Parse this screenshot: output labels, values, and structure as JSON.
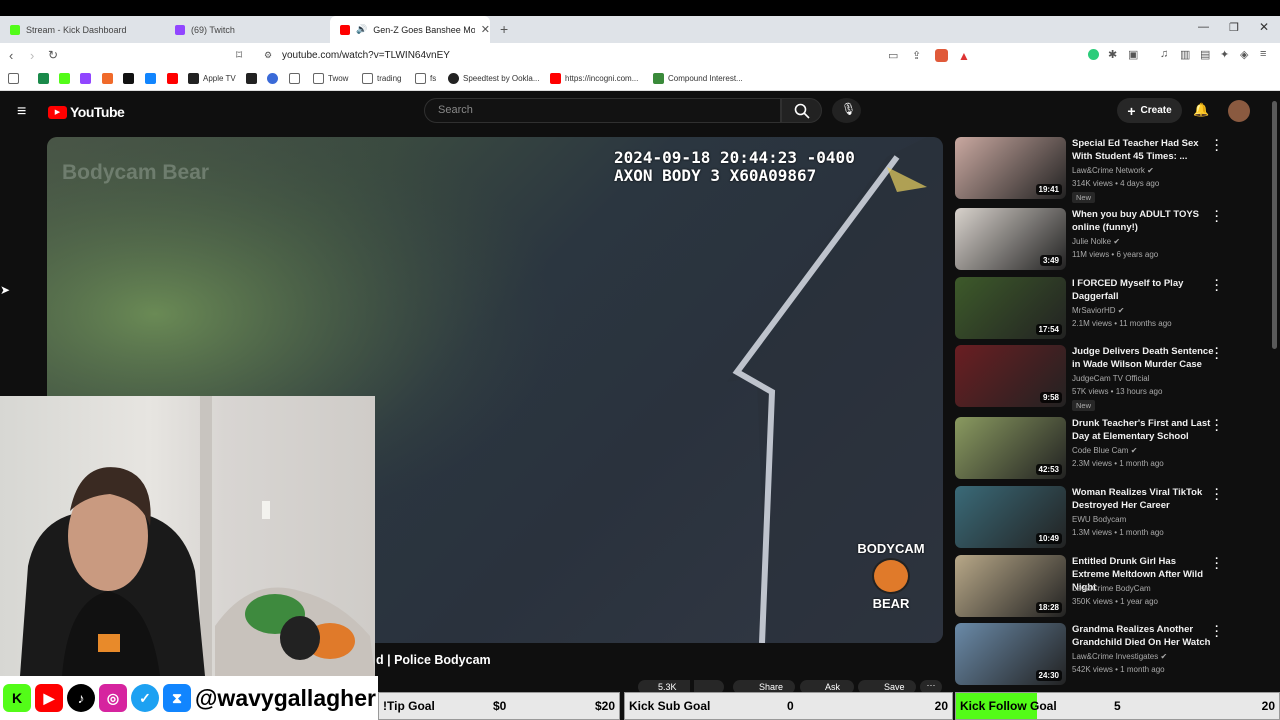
{
  "browser": {
    "tabs": [
      {
        "label": "Stream - Kick Dashboard",
        "color": "#53fc18"
      },
      {
        "label": "(69) Twitch",
        "color": "#9146ff"
      },
      {
        "label": "Gen-Z Goes Banshee Mode O",
        "color": "#ff0000"
      }
    ],
    "url": "youtube.com/watch?v=TLWIN64vnEY",
    "bookmarks": [
      "Apple TV",
      "Twow",
      "trading",
      "fs",
      "Speedtest by Ookla...",
      "https://incogni.com...",
      "Compound Interest..."
    ]
  },
  "youtube": {
    "logo": "YouTube",
    "search_placeholder": "Search",
    "create_label": "Create",
    "video": {
      "overlay_channel": "Bodycam Bear",
      "timestamp": "2024-09-18 20:44:23 -0400",
      "camera": "AXON BODY 3 X60A09867",
      "watermark_top": "BODYCAM",
      "watermark_bottom": "BEAR",
      "title_fragment": "d | Police Bodycam",
      "likes": "5.3K",
      "share": "Share",
      "ask": "Ask",
      "save": "Save"
    },
    "suggestions": [
      {
        "title": "Special Ed Teacher Had Sex With Student 45 Times: ...",
        "channel": "Law&Crime Network",
        "verified": true,
        "meta": "314K views • 4 days ago",
        "badge": "New",
        "duration": "19:41",
        "thumb": "#c9a8a0"
      },
      {
        "title": "When you buy ADULT TOYS online (funny!)",
        "channel": "Julie Nolke",
        "verified": true,
        "meta": "11M views • 6 years ago",
        "badge": "",
        "duration": "3:49",
        "thumb": "#d8d2cc"
      },
      {
        "title": "I FORCED Myself to Play Daggerfall",
        "channel": "MrSaviorHD",
        "verified": true,
        "meta": "2.1M views • 11 months ago",
        "badge": "",
        "duration": "17:54",
        "thumb": "#3d5a2a"
      },
      {
        "title": "Judge Delivers Death Sentence in Wade Wilson Murder Case",
        "channel": "JudgeCam TV Official",
        "verified": false,
        "meta": "57K views • 13 hours ago",
        "badge": "New",
        "duration": "9:58",
        "thumb": "#6a1e22"
      },
      {
        "title": "Drunk Teacher's First and Last Day at Elementary School",
        "channel": "Code Blue Cam",
        "verified": true,
        "meta": "2.3M views • 1 month ago",
        "badge": "",
        "duration": "42:53",
        "thumb": "#8a9a60"
      },
      {
        "title": "Woman Realizes Viral TikTok Destroyed Her Career",
        "channel": "EWU Bodycam",
        "verified": false,
        "meta": "1.3M views • 1 month ago",
        "badge": "",
        "duration": "10:49",
        "thumb": "#3a6a78"
      },
      {
        "title": "Entitled Drunk Girl Has Extreme Meltdown After Wild Night",
        "channel": "Law&Crime BodyCam",
        "verified": false,
        "meta": "350K views • 1 year ago",
        "badge": "",
        "duration": "18:28",
        "thumb": "#b8a888"
      },
      {
        "title": "Grandma Realizes Another Grandchild Died On Her Watch",
        "channel": "Law&Crime Investigates",
        "verified": true,
        "meta": "542K views • 1 month ago",
        "badge": "",
        "duration": "24:30",
        "thumb": "#6a8aa8"
      }
    ]
  },
  "overlay": {
    "handle": "@wavygallagher",
    "goals": [
      {
        "name": "!Tip Goal",
        "current": "$0",
        "target": "$20",
        "progress": 0
      },
      {
        "name": "Kick Sub Goal",
        "current": "0",
        "target": "20",
        "progress": 0
      },
      {
        "name": "Kick Follow Goal",
        "current": "5",
        "target": "20",
        "progress": 0.25
      }
    ]
  }
}
